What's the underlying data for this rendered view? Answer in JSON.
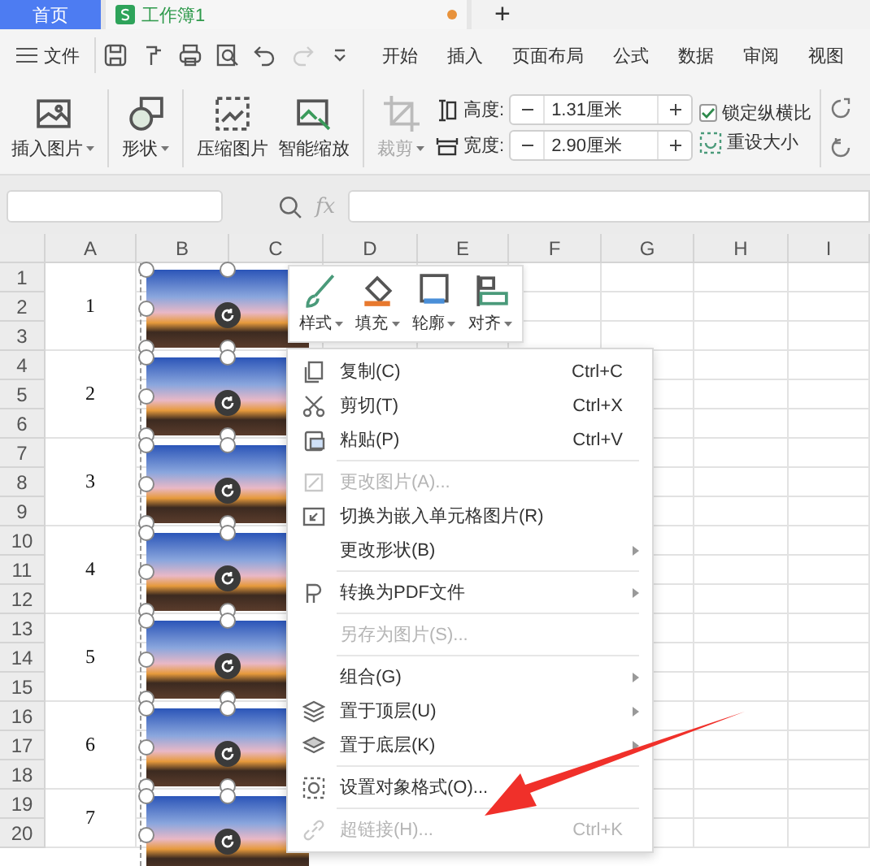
{
  "tabs": [
    {
      "label": "首页",
      "selected": false
    },
    {
      "label": "工作簿1",
      "selected": true,
      "modified": true
    }
  ],
  "new_tab": "+",
  "menu_bar": {
    "file": "文件",
    "items": [
      "开始",
      "插入",
      "页面布局",
      "公式",
      "数据",
      "审阅",
      "视图"
    ]
  },
  "ribbon": {
    "buttons": [
      {
        "label": "插入图片",
        "dropdown": true,
        "disabled": false
      },
      {
        "label": "形状",
        "dropdown": true,
        "disabled": false
      },
      {
        "label": "压缩图片",
        "dropdown": false,
        "disabled": false
      },
      {
        "label": "智能缩放",
        "dropdown": false,
        "disabled": false
      },
      {
        "label": "裁剪",
        "dropdown": true,
        "disabled": true
      }
    ],
    "size_fields": [
      {
        "label": "高度:",
        "value": "1.31厘米"
      },
      {
        "label": "宽度:",
        "value": "2.90厘米"
      }
    ],
    "lock_ratio": {
      "label": "锁定纵横比",
      "checked": true
    },
    "reset_size": "重设大小"
  },
  "formula_bar": {
    "fx": "fx"
  },
  "sheet": {
    "columns": [
      "A",
      "B",
      "C",
      "D",
      "E",
      "F",
      "G",
      "H",
      "I"
    ],
    "rows": [
      "1",
      "2",
      "3",
      "4",
      "5",
      "6",
      "7",
      "8",
      "9",
      "10",
      "11",
      "12",
      "13",
      "14",
      "15",
      "16",
      "17",
      "18",
      "19",
      "20"
    ],
    "column_a_values": [
      "1",
      "2",
      "3",
      "4",
      "5",
      "6",
      "7"
    ],
    "pictures": [
      {
        "selected": true
      },
      {
        "selected": true
      },
      {
        "selected": true
      },
      {
        "selected": true
      },
      {
        "selected": true
      },
      {
        "selected": true
      },
      {
        "selected": true
      }
    ]
  },
  "mini_toolbar": [
    "样式",
    "填充",
    "轮廓",
    "对齐"
  ],
  "context_menu": [
    {
      "label": "复制(C)",
      "shortcut": "Ctrl+C",
      "disabled": false,
      "submenu": false,
      "separator_after": false
    },
    {
      "label": "剪切(T)",
      "shortcut": "Ctrl+X",
      "disabled": false,
      "submenu": false,
      "separator_after": false
    },
    {
      "label": "粘贴(P)",
      "shortcut": "Ctrl+V",
      "disabled": false,
      "submenu": false,
      "separator_after": true
    },
    {
      "label": "更改图片(A)...",
      "disabled": true,
      "submenu": false,
      "separator_after": false
    },
    {
      "label": "切换为嵌入单元格图片(R)",
      "disabled": false,
      "submenu": false,
      "separator_after": false
    },
    {
      "label": "更改形状(B)",
      "disabled": false,
      "submenu": true,
      "separator_after": true
    },
    {
      "label": "转换为PDF文件",
      "disabled": false,
      "submenu": true,
      "separator_after": true
    },
    {
      "label": "另存为图片(S)...",
      "disabled": true,
      "submenu": false,
      "separator_after": true
    },
    {
      "label": "组合(G)",
      "disabled": false,
      "submenu": true,
      "separator_after": false
    },
    {
      "label": "置于顶层(U)",
      "disabled": false,
      "submenu": true,
      "separator_after": false
    },
    {
      "label": "置于底层(K)",
      "disabled": false,
      "submenu": true,
      "separator_after": true
    },
    {
      "label": "设置对象格式(O)...",
      "disabled": false,
      "submenu": false,
      "separator_after": true
    },
    {
      "label": "超链接(H)...",
      "shortcut": "Ctrl+K",
      "disabled": true,
      "submenu": false,
      "separator_after": false
    }
  ]
}
